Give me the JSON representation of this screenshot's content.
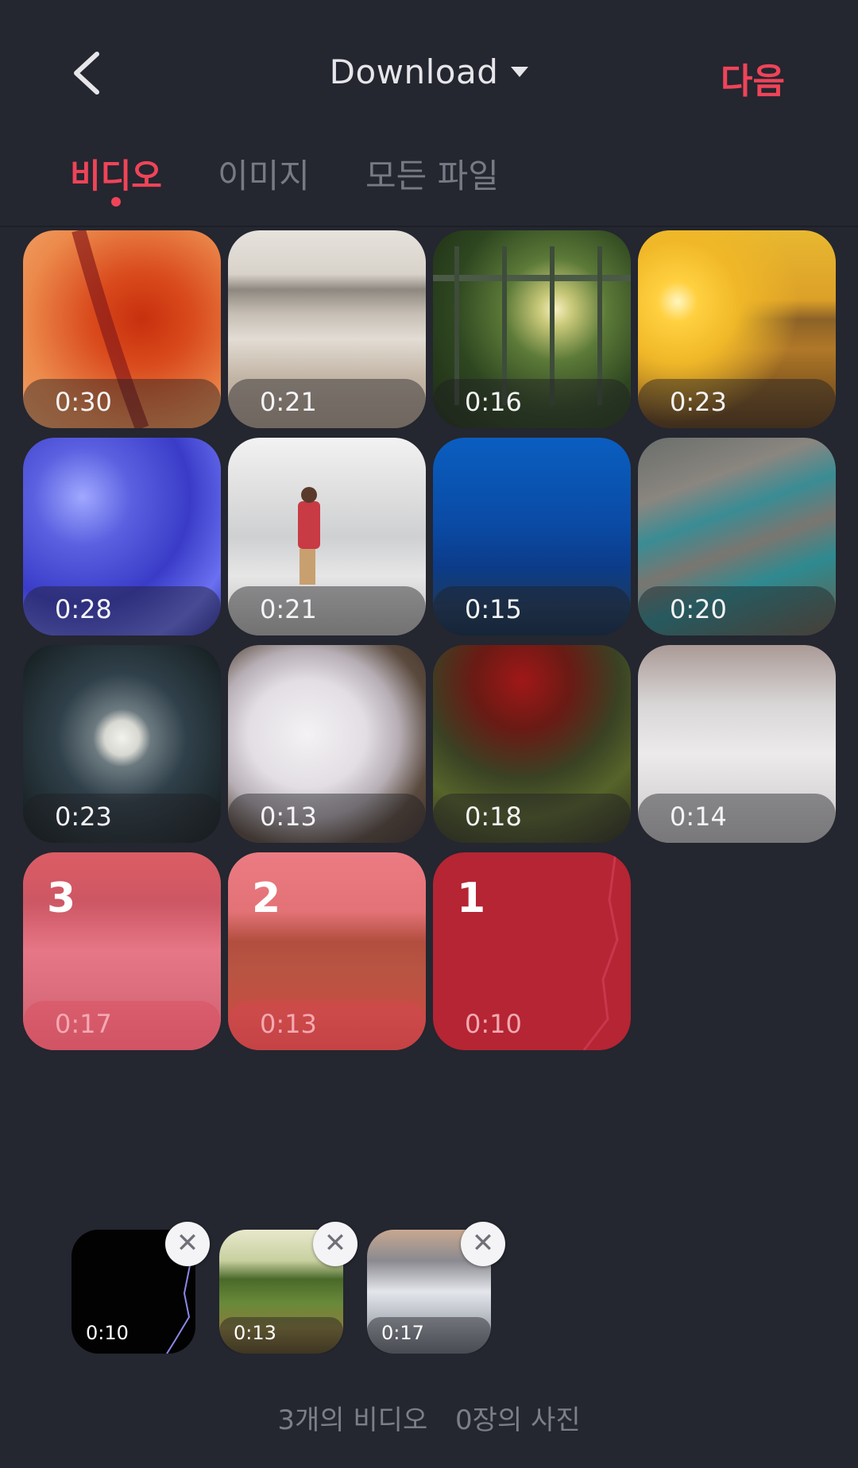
{
  "header": {
    "folder_name": "Download",
    "next_label": "다음"
  },
  "tabs": [
    {
      "label": "비디오",
      "active": true
    },
    {
      "label": "이미지",
      "active": false
    },
    {
      "label": "모든 파일",
      "active": false
    }
  ],
  "videos": [
    {
      "duration": "0:30",
      "selected_order": null
    },
    {
      "duration": "0:21",
      "selected_order": null
    },
    {
      "duration": "0:16",
      "selected_order": null
    },
    {
      "duration": "0:23",
      "selected_order": null
    },
    {
      "duration": "0:28",
      "selected_order": null
    },
    {
      "duration": "0:21",
      "selected_order": null
    },
    {
      "duration": "0:15",
      "selected_order": null
    },
    {
      "duration": "0:20",
      "selected_order": null
    },
    {
      "duration": "0:23",
      "selected_order": null
    },
    {
      "duration": "0:13",
      "selected_order": null
    },
    {
      "duration": "0:18",
      "selected_order": null
    },
    {
      "duration": "0:14",
      "selected_order": null
    },
    {
      "duration": "0:17",
      "selected_order": "3"
    },
    {
      "duration": "0:13",
      "selected_order": "2"
    },
    {
      "duration": "0:10",
      "selected_order": "1"
    }
  ],
  "selected_tray": [
    {
      "duration": "0:10",
      "remove_label": "✕"
    },
    {
      "duration": "0:13",
      "remove_label": "✕"
    },
    {
      "duration": "0:17",
      "remove_label": "✕"
    }
  ],
  "summary": {
    "videos_text": "3개의 비디오",
    "photos_text": "0장의 사진"
  },
  "colors": {
    "background": "#242630",
    "accent": "#ef4458",
    "inactive_tab": "#777a84"
  }
}
